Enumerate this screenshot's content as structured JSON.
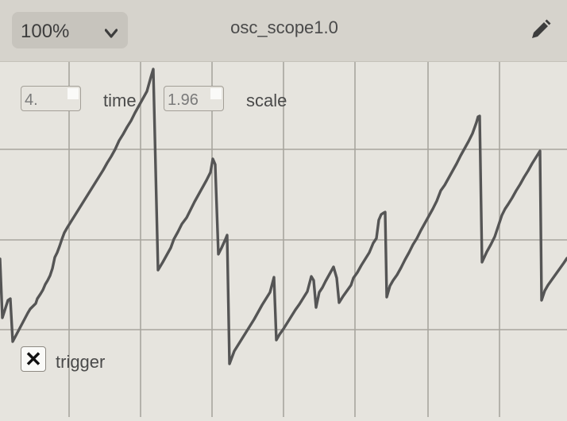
{
  "toolbar": {
    "zoom_label": "100%",
    "window_title": "osc_scope1.0",
    "edit_icon": "pencil-icon"
  },
  "controls": {
    "time": {
      "value": "4.",
      "label": "time"
    },
    "scale": {
      "value": "1.96",
      "label": "scale"
    },
    "trigger": {
      "checked": true,
      "mark": "✕",
      "label": "trigger"
    }
  },
  "scope": {
    "background": "#e6e4de",
    "grid_color": "#a8a59e",
    "trace_color": "#555555"
  }
}
